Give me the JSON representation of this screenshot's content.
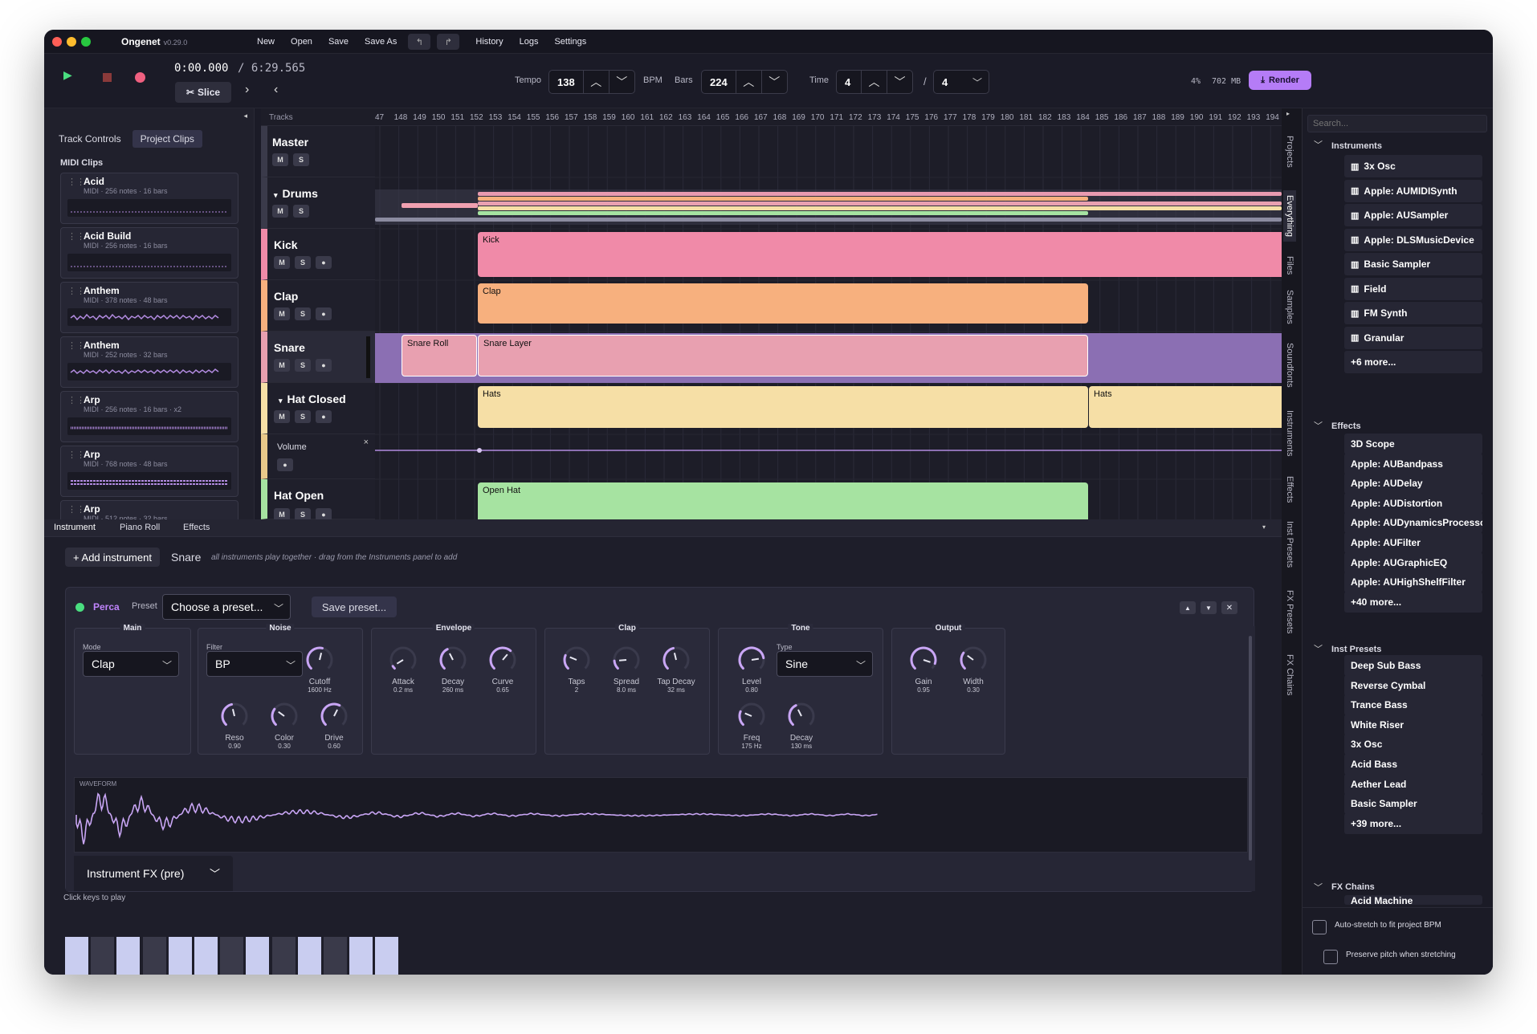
{
  "app": {
    "name": "Ongenet",
    "version": "v0.29.0"
  },
  "menu": [
    "New",
    "Open",
    "Save",
    "Save As",
    "History",
    "Logs",
    "Settings"
  ],
  "transport": {
    "time": "0:00.000",
    "duration": "/ 6:29.565",
    "slice_label": "Slice",
    "tempo_label": "Tempo",
    "tempo": "138",
    "bpm_label": "BPM",
    "bars_label": "Bars",
    "bars": "224",
    "time_label": "Time",
    "time_num": "4",
    "time_sep": "/",
    "time_den": "4",
    "cpu": "4%",
    "mem": "702 MB",
    "render_label": "Render"
  },
  "sidebar": {
    "tabs": [
      "Track Controls",
      "Project Clips"
    ],
    "section": "MIDI Clips",
    "clips": [
      {
        "name": "Acid",
        "meta": "MIDI · 256 notes · 16 bars"
      },
      {
        "name": "Acid Build",
        "meta": "MIDI · 256 notes · 16 bars"
      },
      {
        "name": "Anthem",
        "meta": "MIDI · 378 notes · 48 bars"
      },
      {
        "name": "Anthem",
        "meta": "MIDI · 252 notes · 32 bars"
      },
      {
        "name": "Arp",
        "meta": "MIDI · 256 notes · 16 bars · x2"
      },
      {
        "name": "Arp",
        "meta": "MIDI · 768 notes · 48 bars"
      },
      {
        "name": "Arp",
        "meta": "MIDI · 512 notes · 32 bars"
      }
    ]
  },
  "tracks_panel": {
    "header": "Tracks",
    "ruler": [
      "47",
      "148",
      "149",
      "150",
      "151",
      "152",
      "153",
      "154",
      "155",
      "156",
      "157",
      "158",
      "159",
      "160",
      "161",
      "162",
      "163",
      "164",
      "165",
      "166",
      "167",
      "168",
      "169",
      "170",
      "171",
      "172",
      "173",
      "174",
      "175",
      "176",
      "177",
      "178",
      "179",
      "180",
      "181",
      "182",
      "183",
      "184",
      "185",
      "186",
      "187",
      "188",
      "189",
      "190",
      "191",
      "192",
      "193",
      "194"
    ],
    "tracks": [
      {
        "name": "Master",
        "color": "#3a3a4a"
      },
      {
        "name": "Drums",
        "color": "#e07a9a"
      },
      {
        "name": "Kick",
        "color": "#f08aa8"
      },
      {
        "name": "Clap",
        "color": "#f7b07e"
      },
      {
        "name": "Snare",
        "color": "#e8a0b0"
      },
      {
        "name": "Hat Closed",
        "color": "#f6dfa6"
      },
      {
        "name": "Hat Open",
        "color": "#a6e3a1"
      }
    ],
    "automation_label": "Volume",
    "clips": {
      "kick": "Kick",
      "clap": "Clap",
      "snare_roll": "Snare Roll",
      "snare_layer": "Snare Layer",
      "hats": "Hats",
      "hats2": "Hats",
      "open_hat": "Open Hat"
    },
    "mute": "M",
    "solo": "S",
    "arm": "●",
    "close": "×"
  },
  "bottom": {
    "tabs": [
      "Instrument",
      "Piano Roll",
      "Effects"
    ],
    "add_instrument": "+ Add instrument",
    "track_name": "Snare",
    "hint": "all instruments play together · drag from the Instruments panel to add",
    "instrument": {
      "name": "Perca",
      "preset_label": "Preset",
      "preset_value": "Choose a preset...",
      "save_preset": "Save preset...",
      "sections": {
        "main": "Main",
        "noise": "Noise",
        "envelope": "Envelope",
        "clap": "Clap",
        "tone": "Tone",
        "output": "Output"
      },
      "mode_label": "Mode",
      "mode": "Clap",
      "filter_label": "Filter",
      "filter": "BP",
      "type_label": "Type",
      "type": "Sine",
      "knobs": {
        "cutoff": {
          "label": "Cutoff",
          "value": "1600 Hz",
          "level": 0.55
        },
        "reso": {
          "label": "Reso",
          "value": "0.90",
          "level": 0.45
        },
        "color": {
          "label": "Color",
          "value": "0.30",
          "level": 0.3
        },
        "drive": {
          "label": "Drive",
          "value": "0.60",
          "level": 0.6
        },
        "attack": {
          "label": "Attack",
          "value": "0.2 ms",
          "level": 0.05
        },
        "decay": {
          "label": "Decay",
          "value": "260 ms",
          "level": 0.4
        },
        "curve": {
          "label": "Curve",
          "value": "0.65",
          "level": 0.65
        },
        "taps": {
          "label": "Taps",
          "value": "2",
          "level": 0.25
        },
        "spread": {
          "label": "Spread",
          "value": "8.0 ms",
          "level": 0.15
        },
        "tapdecay": {
          "label": "Tap Decay",
          "value": "32 ms",
          "level": 0.45
        },
        "level": {
          "label": "Level",
          "value": "0.80",
          "level": 0.8
        },
        "freq": {
          "label": "Freq",
          "value": "175 Hz",
          "level": 0.25
        },
        "tdecay": {
          "label": "Decay",
          "value": "130 ms",
          "level": 0.4
        },
        "gain": {
          "label": "Gain",
          "value": "0.95",
          "level": 0.9
        },
        "width": {
          "label": "Width",
          "value": "0.30",
          "level": 0.3
        }
      },
      "waveform_label": "WAVEFORM",
      "fx_pre": "Instrument FX (pre)"
    },
    "keys_label": "Click keys to play",
    "keys": [
      "C4",
      "C#4",
      "D4",
      "D#4",
      "E4",
      "F4",
      "F#4",
      "G4",
      "G#4",
      "A4",
      "A#4",
      "B4",
      "C5"
    ]
  },
  "right_tabs": [
    "Projects",
    "Everything",
    "Files",
    "Samples",
    "Soundfonts",
    "Instruments",
    "Effects",
    "Inst Presets",
    "FX Presets",
    "FX Chains"
  ],
  "browser": {
    "search_placeholder": "Search...",
    "instruments_header": "Instruments",
    "instruments": [
      "3x Osc",
      "Apple: AUMIDISynth",
      "Apple: AUSampler",
      "Apple: DLSMusicDevice",
      "Basic Sampler",
      "Field",
      "FM Synth",
      "Granular"
    ],
    "instruments_more": "+6 more...",
    "effects_header": "Effects",
    "effects": [
      "3D Scope",
      "Apple: AUBandpass",
      "Apple: AUDelay",
      "Apple: AUDistortion",
      "Apple: AUDynamicsProcessor",
      "Apple: AUFilter",
      "Apple: AUGraphicEQ",
      "Apple: AUHighShelfFilter"
    ],
    "effects_more": "+40 more...",
    "inst_presets_header": "Inst Presets",
    "inst_presets": [
      "Deep Sub Bass",
      "Reverse Cymbal",
      "Trance Bass",
      "White Riser",
      "3x Osc",
      "Acid Bass",
      "Aether Lead",
      "Basic Sampler"
    ],
    "inst_presets_more": "+39 more...",
    "fx_chains_header": "FX Chains",
    "fx_chains_first": "Acid Machine",
    "auto_stretch": "Auto-stretch to fit project BPM",
    "preserve_pitch": "Preserve pitch when stretching"
  },
  "colors": {
    "accent": "#c084fc",
    "render": "#b57cf7",
    "kick": "#f08aa8",
    "clap": "#f7b07e",
    "snare": "#e8a0b0",
    "hats": "#f6dfa6",
    "openhat": "#a6e3a1",
    "snare_row": "#8b6fb3"
  }
}
